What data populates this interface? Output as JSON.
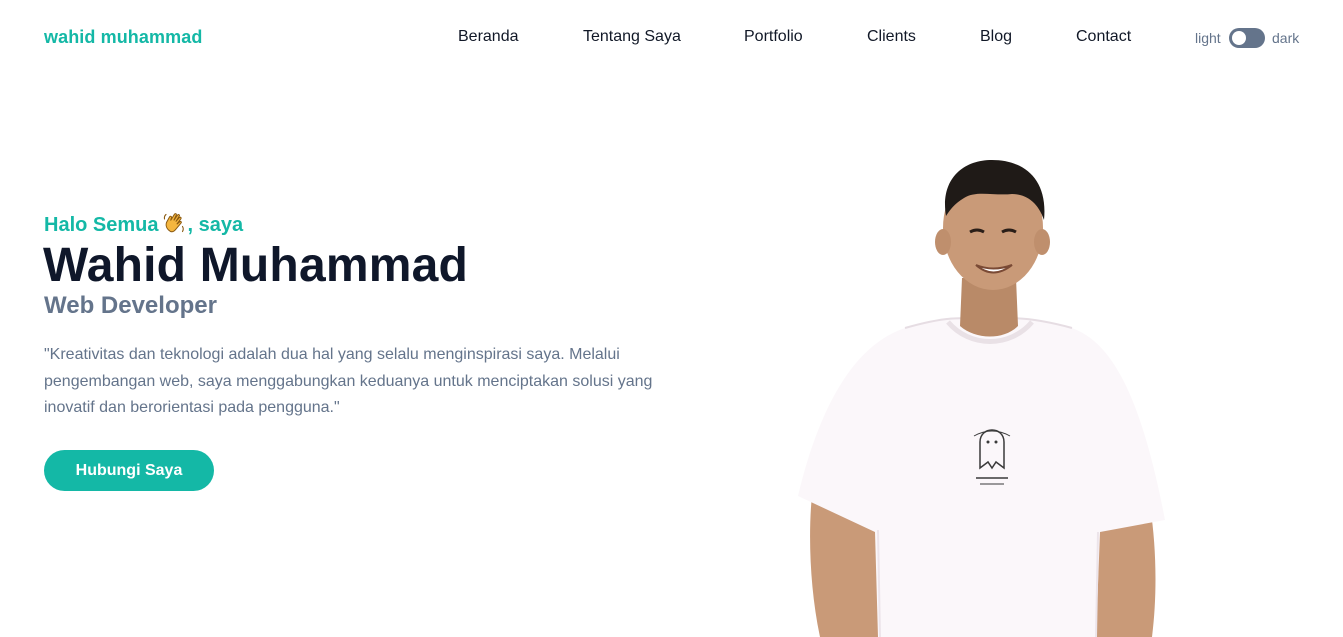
{
  "navbar": {
    "brand": "wahid muhammad",
    "links": [
      {
        "label": "Beranda"
      },
      {
        "label": "Tentang Saya"
      },
      {
        "label": "Portfolio"
      },
      {
        "label": "Clients"
      },
      {
        "label": "Blog"
      },
      {
        "label": "Contact"
      }
    ],
    "theme_toggle": {
      "light_label": "light",
      "dark_label": "dark",
      "state": "light"
    }
  },
  "hero": {
    "greeting_prefix": "Halo Semua",
    "greeting_emoji": "waving-hand-icon",
    "greeting_suffix": ", saya",
    "name": "Wahid Muhammad",
    "role": "Web Developer",
    "quote": "\"Kreativitas dan teknologi adalah dua hal yang selalu menginspirasi saya. Melalui pengembangan web, saya menggabungkan keduanya untuk menciptakan solusi yang inovatif dan berorientasi pada pengguna.\"",
    "cta_label": "Hubungi Saya"
  },
  "colors": {
    "accent": "#14b8a6",
    "heading": "#0f172a",
    "muted": "#64748b",
    "nav_text": "#111827",
    "background": "#ffffff"
  }
}
